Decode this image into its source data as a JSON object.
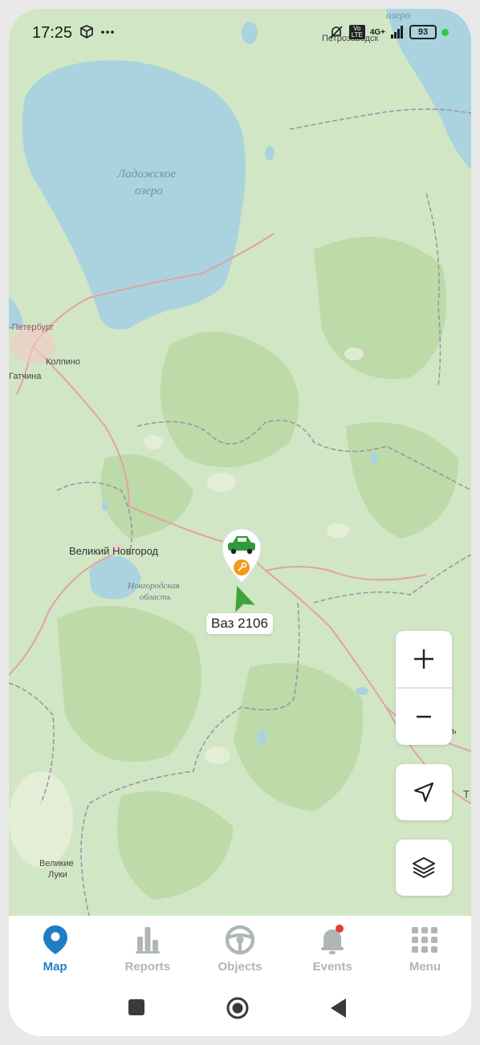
{
  "status": {
    "time": "17:25",
    "network": "4G+",
    "volte": "Vo LTE",
    "battery": "93",
    "colors": {
      "charging_dot": "#2ecc40"
    }
  },
  "map": {
    "labels": {
      "lake_ladoga_1": "Ладожское",
      "lake_ladoga_2": "озеро",
      "onega": "озеро",
      "petrozavodsk": "Петрозаводск",
      "spb": "Санкт-Петербург",
      "spb_visible": "-Петербург",
      "kolpino": "Колпино",
      "gatchina": "Гатчина",
      "novgorod": "Великий Новгород",
      "novgorod_obl_1": "Новгородская",
      "novgorod_obl_2": "область",
      "velikie_luki_1": "Великие",
      "velikie_luki_2": "Луки",
      "edge_t": "Т",
      "edge_b": "ь"
    },
    "vehicle": {
      "name": "Ваз 2106",
      "icon": "car-icon",
      "status_icon": "ignition-key-icon",
      "direction_icon": "direction-arrow-icon"
    },
    "colors": {
      "water": "#aad3df",
      "land": "#d1e6c4",
      "forest": "#b8d8a6",
      "road": "#e3a0a0",
      "border": "#9b8fa8",
      "marker_status": "#f29b1c",
      "arrow": "#3fa33a",
      "car": "#2f9a3a"
    }
  },
  "controls": {
    "zoom_in_icon": "plus-icon",
    "zoom_out_icon": "minus-icon",
    "locate_icon": "navigation-arrow-icon",
    "layers_icon": "layers-icon"
  },
  "tabs": [
    {
      "label": "Map",
      "icon": "map-pin-icon",
      "active": true
    },
    {
      "label": "Reports",
      "icon": "bar-chart-icon",
      "active": false
    },
    {
      "label": "Objects",
      "icon": "steering-wheel-icon",
      "active": false
    },
    {
      "label": "Events",
      "icon": "bell-icon",
      "active": false
    },
    {
      "label": "Menu",
      "icon": "grid-icon",
      "active": false
    }
  ],
  "colors": {
    "accent": "#1f7ec2",
    "inactive": "#b0b5b8",
    "badge": "#e53935"
  }
}
